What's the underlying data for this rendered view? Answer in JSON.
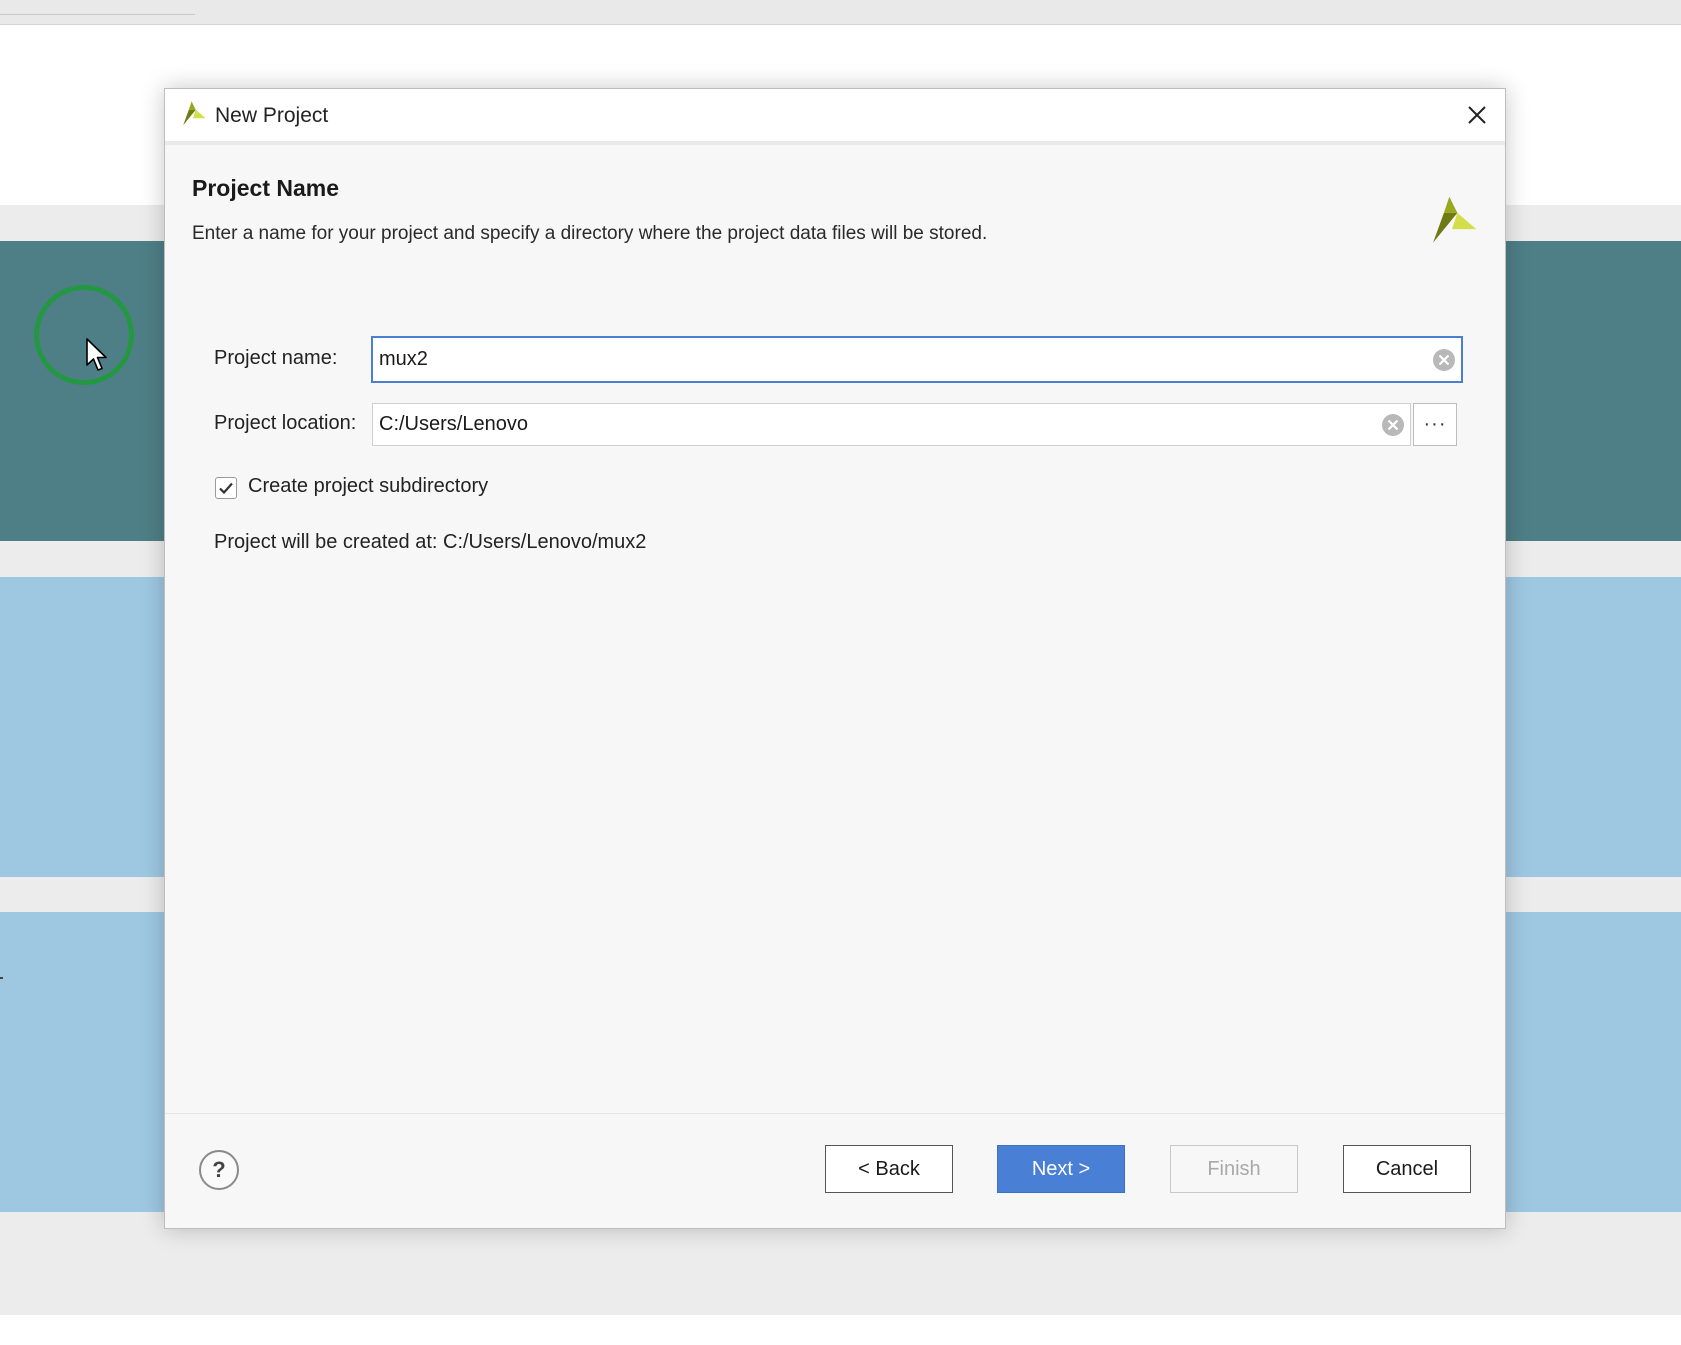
{
  "dialog": {
    "title": "New Project",
    "close_icon": "close-icon",
    "logo_icon": "xilinx-logo-icon"
  },
  "page": {
    "title": "Project Name",
    "description": "Enter a name for your project and specify a directory where the project data files will be stored."
  },
  "form": {
    "project_name_label": "Project name:",
    "project_name_value": "mux2",
    "project_location_label": "Project location:",
    "project_location_value": "C:/Users/Lenovo",
    "browse_label": "···",
    "create_subdir_label": "Create project subdirectory",
    "create_subdir_checked": true,
    "result_path": "Project will be created at: C:/Users/Lenovo/mux2"
  },
  "footer": {
    "help_label": "?",
    "back_label": "< Back",
    "next_label": "Next >",
    "finish_label": "Finish",
    "cancel_label": "Cancel"
  },
  "colors": {
    "accent": "#4a7fd6",
    "teal_band": "#4e7f86",
    "blue_band": "#9ec8e2",
    "cursor_ring": "#1f9a3a"
  }
}
